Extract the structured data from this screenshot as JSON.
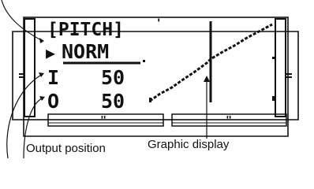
{
  "screen": {
    "title": "[PITCH]",
    "mode": "NORM",
    "mode_marker": "▶",
    "input_label": "I",
    "input_value": "50",
    "output_label": "O",
    "output_value": "50",
    "trim_mark": "\""
  },
  "captions": {
    "output_position": "Output position",
    "graphic_display": "Graphic display"
  },
  "colors": {
    "ink": "#111111",
    "background": "#ffffff"
  }
}
